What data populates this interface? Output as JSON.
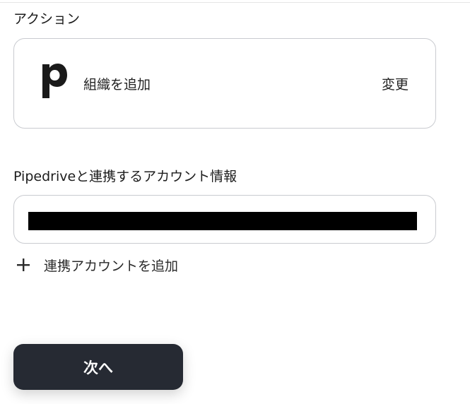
{
  "action_section": {
    "title": "アクション",
    "app_icon": "pipedrive-logo",
    "action_label": "組織を追加",
    "change_label": "変更"
  },
  "account_section": {
    "title": "Pipedriveと連携するアカウント情報",
    "value_redacted": true,
    "add_account_label": "連携アカウントを追加"
  },
  "footer": {
    "next_label": "次へ"
  },
  "colors": {
    "button_bg": "#262a33",
    "card_border": "#c9cbd0"
  }
}
